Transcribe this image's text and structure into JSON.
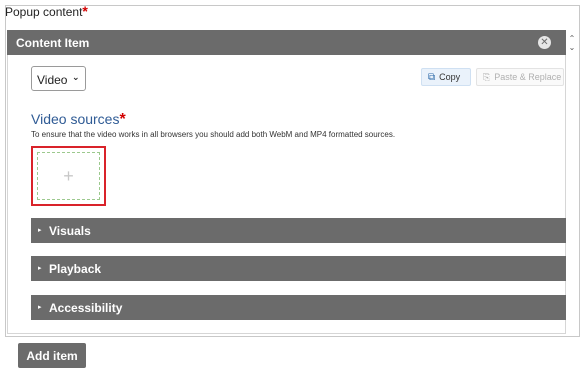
{
  "popup": {
    "label": "Popup content",
    "required_mark": "*"
  },
  "content_item": {
    "title": "Content Item",
    "close_glyph": "✕",
    "sort_up": "⌃",
    "sort_down": "⌄"
  },
  "type_select": {
    "value": "Video",
    "chevron": "⌄"
  },
  "actions": {
    "copy_label": "Copy",
    "paste_label": "Paste & Replace"
  },
  "video_sources": {
    "title": "Video sources",
    "required_mark": "*",
    "description": "To ensure that the video works in all browsers you should add both WebM and MP4 formatted sources.",
    "add_glyph": "+"
  },
  "sections": [
    {
      "label": "Visuals",
      "arrow": "▸"
    },
    {
      "label": "Playback",
      "arrow": "▸"
    },
    {
      "label": "Accessibility",
      "arrow": "▸"
    }
  ],
  "add_item_label": "Add item",
  "colors": {
    "header_bg": "#6b6b6b",
    "title_blue": "#2f5b95",
    "required_red": "#d20000",
    "highlight_red": "#d9232a"
  }
}
